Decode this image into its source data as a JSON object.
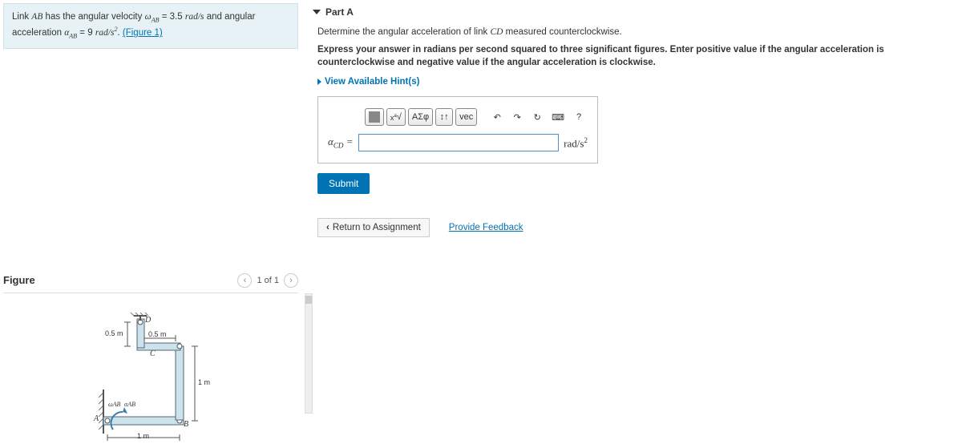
{
  "problem": {
    "pre": "Link ",
    "var_ab": "AB",
    "mid1": " has the angular velocity ",
    "omega_sub": "AB",
    "eq1": " = 3.5 ",
    "unit1": "rad/s",
    "mid2": " and angular acceleration ",
    "alpha_sub": "AB",
    "eq2": " = 9 ",
    "unit2_base": "rad/s",
    "unit2_exp": "2",
    "post": ". ",
    "figure_link": "(Figure 1)"
  },
  "figure": {
    "title": "Figure",
    "nav_text": "1 of 1",
    "dims": {
      "d05m_a": "0.5 m",
      "d05m_b": "0.5 m",
      "d1m_a": "1 m",
      "d1m_b": "1 m",
      "pt_a": "A",
      "pt_b": "B",
      "pt_c": "C",
      "pt_d": "D",
      "w_ab": "ωAB",
      "a_ab": "αAB"
    }
  },
  "partA": {
    "header": "Part A",
    "instr1_pre": "Determine the angular acceleration of link ",
    "instr1_var": "CD",
    "instr1_post": " measured counterclockwise.",
    "instr2": "Express your answer in radians per second squared to three significant figures. Enter positive value if the angular acceleration is counterclockwise and negative value if the angular acceleration is clockwise.",
    "hints": "View Available Hint(s)",
    "toolbar": {
      "templates": "",
      "sqrt": "√",
      "greek": "ΑΣφ",
      "arrows": "↕↑",
      "vec": "vec",
      "undo": "↶",
      "redo": "↷",
      "reset": "↻",
      "keyboard": "⌨",
      "help": "?"
    },
    "var_label_sym": "α",
    "var_label_sub": "CD",
    "var_label_eq": " = ",
    "unit_base": "rad/s",
    "unit_exp": "2",
    "submit": "Submit"
  },
  "footer": {
    "return": "Return to Assignment",
    "feedback": "Provide Feedback"
  }
}
